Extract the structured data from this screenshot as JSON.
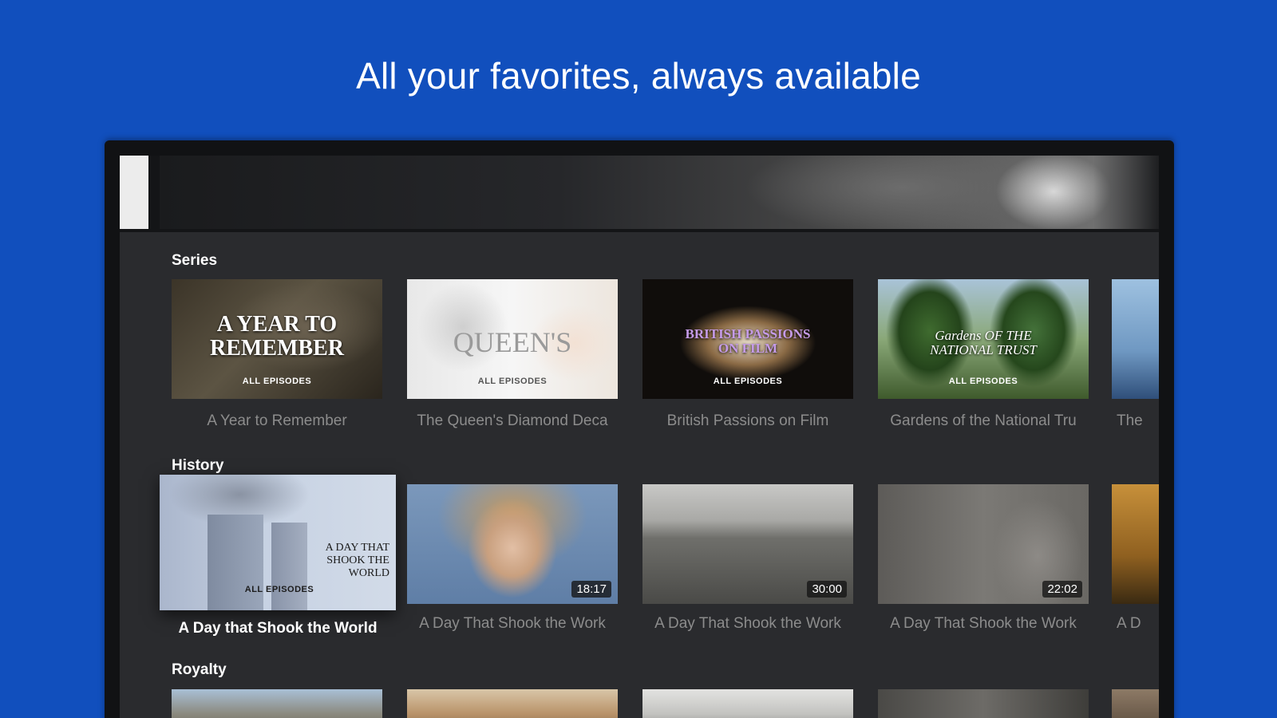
{
  "headline": "All your favorites, always available",
  "colors": {
    "background": "#114fbd",
    "screen": "#2a2b2e",
    "label": "#8c8c8c"
  },
  "rows": [
    {
      "title": "Series",
      "cards": [
        {
          "label": "A Year to Remember",
          "thumb_title": "A YEAR TO REMEMBER",
          "thumb_sub": "ALL EPISODES"
        },
        {
          "label": "The Queen's Diamond Deca",
          "thumb_title": "QUEEN'S",
          "thumb_sub": "ALL EPISODES"
        },
        {
          "label": "British Passions on Film",
          "thumb_title": "BRITISH PASSIONS ON FILM",
          "thumb_sub": "ALL EPISODES"
        },
        {
          "label": "Gardens of the National Tru",
          "thumb_title": "Gardens OF THE NATIONAL TRUST",
          "thumb_sub": "ALL EPISODES"
        },
        {
          "label": "The"
        }
      ]
    },
    {
      "title": "History",
      "cards": [
        {
          "label": "A Day that Shook the World",
          "thumb_title": "A DAY THAT SHOOK THE WORLD",
          "thumb_sub": "ALL EPISODES"
        },
        {
          "label": "A Day That Shook the Work",
          "duration": "18:17"
        },
        {
          "label": "A Day That Shook the Work",
          "duration": "30:00"
        },
        {
          "label": "A Day That Shook the Work",
          "duration": "22:02"
        },
        {
          "label": "A D"
        }
      ]
    },
    {
      "title": "Royalty"
    }
  ]
}
